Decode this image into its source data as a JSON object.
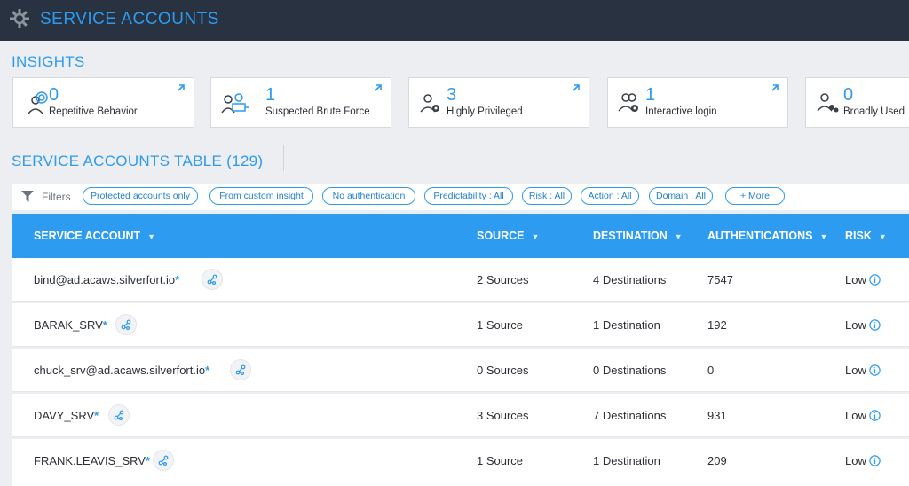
{
  "header": {
    "title": "SERVICE ACCOUNTS",
    "logo_icon": "gear-icon"
  },
  "insights": {
    "title": "INSIGHTS",
    "cards": [
      {
        "count": "0",
        "label": "Repetitive Behavior",
        "icon": "repetitive-behavior-icon"
      },
      {
        "count": "1",
        "label": "Suspected Brute Force",
        "icon": "brute-force-icon"
      },
      {
        "count": "3",
        "label": "Highly Privileged",
        "icon": "privileged-user-icon"
      },
      {
        "count": "1",
        "label": "Interactive login",
        "icon": "interactive-login-icon"
      },
      {
        "count": "0",
        "label": "Broadly Used",
        "icon": "broadly-used-icon"
      }
    ]
  },
  "table": {
    "title": "SERVICE ACCOUNTS TABLE (129)",
    "filters_label": "Filters",
    "filter_chips": [
      "Protected accounts only",
      "From custom insight",
      "No authentication",
      "Predictability : All",
      "Risk : All",
      "Action : All",
      "Domain : All",
      "+ More"
    ],
    "columns": [
      "SERVICE ACCOUNT",
      "SOURCE",
      "DESTINATION",
      "AUTHENTICATIONS",
      "RISK"
    ],
    "rows": [
      {
        "account": "bind@ad.acaws.silverfort.io",
        "star": "*",
        "source": "2 Sources",
        "destination": "4 Destinations",
        "authentications": "7547",
        "risk": "Low"
      },
      {
        "account": "BARAK_SRV",
        "star": "*",
        "source": "1 Source",
        "destination": "1 Destination",
        "authentications": "192",
        "risk": "Low"
      },
      {
        "account": "chuck_srv@ad.acaws.silverfort.io",
        "star": "*",
        "source": "0 Sources",
        "destination": "0 Destinations",
        "authentications": "0",
        "risk": "Low"
      },
      {
        "account": "DAVY_SRV",
        "star": "*",
        "source": "3 Sources",
        "destination": "7 Destinations",
        "authentications": "931",
        "risk": "Low"
      },
      {
        "account": "FRANK.LEAVIS_SRV",
        "star": "*",
        "source": "1 Source",
        "destination": "1 Destination",
        "authentications": "209",
        "risk": "Low"
      }
    ]
  },
  "colors": {
    "accent": "#2d9bf0",
    "topbar": "#283240",
    "background": "#eceef2"
  }
}
